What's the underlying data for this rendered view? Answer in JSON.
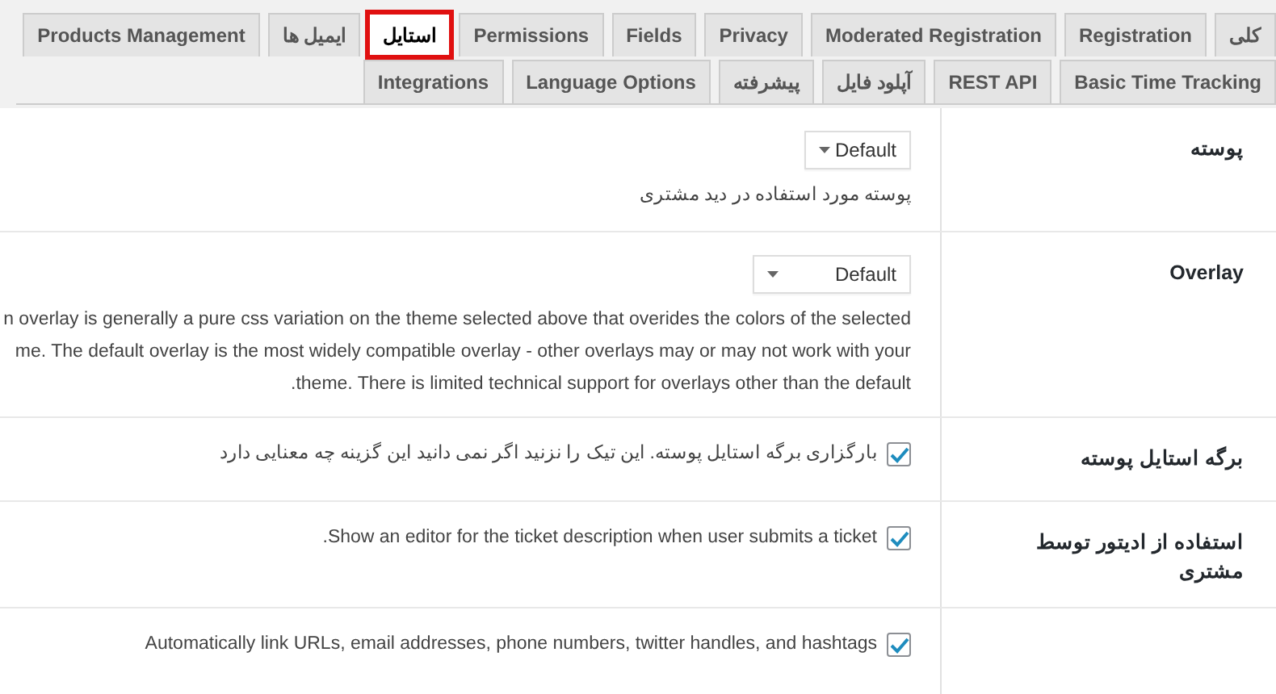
{
  "tab_rows": [
    [
      {
        "label": "کلی",
        "selected": false
      },
      {
        "label": "Registration",
        "selected": false
      },
      {
        "label": "Moderated Registration",
        "selected": false
      },
      {
        "label": "Privacy",
        "selected": false
      },
      {
        "label": "Fields",
        "selected": false
      },
      {
        "label": "Permissions",
        "selected": false
      },
      {
        "label": "استایل",
        "selected": true
      },
      {
        "label": "ایمیل ها",
        "selected": false
      },
      {
        "label": "Products Management",
        "selected": false
      }
    ],
    [
      {
        "label": "Basic Time Tracking",
        "selected": false
      },
      {
        "label": "REST API",
        "selected": false
      },
      {
        "label": "آپلود فایل",
        "selected": false
      },
      {
        "label": "پیشرفته",
        "selected": false
      },
      {
        "label": "Language Options",
        "selected": false
      },
      {
        "label": "Integrations",
        "selected": false
      }
    ]
  ],
  "settings": [
    {
      "kind": "select",
      "label": "پوسته",
      "value": "Default",
      "description": [
        "پوسته مورد استفاده در دید مشتری"
      ]
    },
    {
      "kind": "select",
      "label": "Overlay",
      "value": "Default",
      "description": [
        "n overlay is generally a pure css variation on the theme selected above that overides the colors of the selected",
        "me. The default overlay is the most widely compatible overlay - other overlays may or may not work with your",
        "theme. There is limited technical support for overlays other than the default."
      ]
    },
    {
      "kind": "checkbox",
      "label": "برگه استایل پوسته",
      "checked": true,
      "text": "بارگزاری برگه استایل پوسته. این تیک را نزنید اگر نمی دانید این گزینه چه معنایی دارد"
    },
    {
      "kind": "checkbox",
      "label": "استفاده از ادیتور توسط مشتری",
      "checked": true,
      "text": "Show an editor for the ticket description when user submits a ticket."
    },
    {
      "kind": "checkbox",
      "checked": true,
      "text": "Automatically link URLs, email addresses, phone numbers, twitter handles, and hashtags"
    }
  ]
}
